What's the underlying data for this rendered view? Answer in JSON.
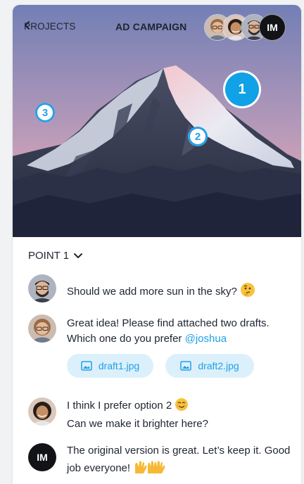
{
  "header": {
    "back_label": "PROJECTS",
    "title": "AD CAMPAIGN",
    "avatars": [
      {
        "name": "user-avatar-1",
        "kind": "photo",
        "skin": "#e9b894",
        "hair": "#9a6a45"
      },
      {
        "name": "user-avatar-2",
        "kind": "photo",
        "skin": "#c58f66",
        "hair": "#2a1d16"
      },
      {
        "name": "user-avatar-3",
        "kind": "photo",
        "skin": "#e0b393",
        "hair": "#222222"
      },
      {
        "name": "user-avatar-im",
        "kind": "initials",
        "initials": "IM"
      }
    ]
  },
  "pins": [
    {
      "label": "1"
    },
    {
      "label": "2"
    },
    {
      "label": "3"
    }
  ],
  "thread": {
    "point_label": "POINT 1",
    "messages": [
      {
        "text": "Should we add more sun in the sky?",
        "emoji": "thinking-face"
      },
      {
        "text": "Great idea! Please find attached two drafts. Which one do you prefer",
        "mention": "@joshua"
      },
      {
        "line1": "I think I prefer option 2",
        "line2": "Can we make it brighter here?",
        "emoji": "smiling-face"
      },
      {
        "text": "The original version is great. Let’s keep it. Good job everyone!",
        "avatar_initials": "IM",
        "emoji": "raising-hands"
      }
    ],
    "attachments": [
      "draft1.jpg",
      "draft2.jpg"
    ]
  },
  "colors": {
    "accent": "#1ea0e6",
    "attachment_bg": "#dcf0fb",
    "text": "#1e2430",
    "sky_top": "#7a86b9",
    "sky_bottom": "#e0a4b3",
    "mountain_dark": "#2b3046"
  }
}
